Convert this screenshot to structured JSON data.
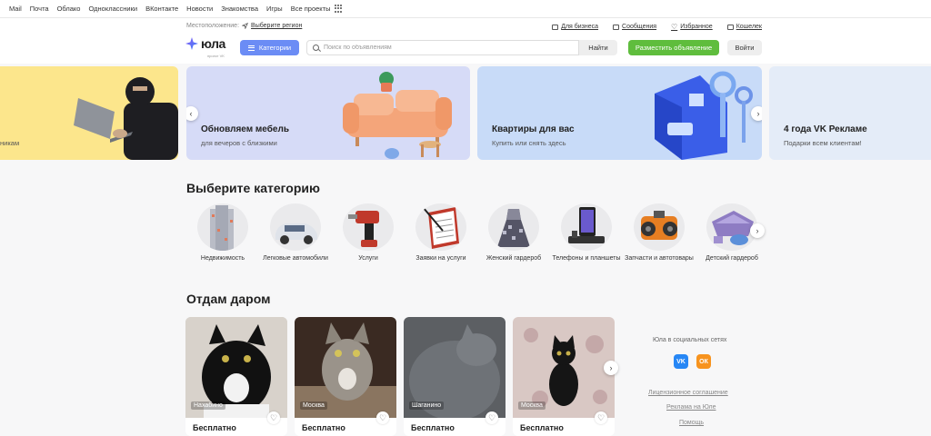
{
  "portal": {
    "links": [
      "Mail",
      "Почта",
      "Облако",
      "Одноклассники",
      "ВКонтакте",
      "Новости",
      "Знакомства",
      "Игры",
      "Все проекты"
    ]
  },
  "header": {
    "location_label": "Местоположение:",
    "location_link": "Выберите регион",
    "top_links": {
      "business": "Для бизнеса",
      "messages": "Сообщения",
      "favorites": "Избранное",
      "wallet": "Кошелек"
    },
    "logo_text": "юла",
    "logo_sub": "проект VK",
    "categories_button": "Категории",
    "search_placeholder": "Поиск по объявлениям",
    "find_button": "Найти",
    "post_button": "Разместить объявление",
    "login_button": "Войти"
  },
  "banners": [
    {
      "title": "",
      "subtitle": "никам"
    },
    {
      "title": "Обновляем мебель",
      "subtitle": "для вечеров с близкими"
    },
    {
      "title": "Квартиры для вас",
      "subtitle": "Купить или снять здесь"
    },
    {
      "title": "4 года VK Рекламе",
      "subtitle": "Подарки всем клиентам!"
    }
  ],
  "categories_section": {
    "title": "Выберите категорию",
    "items": [
      "Недвижимость",
      "Легковые автомобили",
      "Услуги",
      "Заявки на услуги",
      "Женский гардероб",
      "Телефоны и планшеты",
      "Запчасти и автотовары",
      "Детский гардероб"
    ]
  },
  "free_section": {
    "title": "Отдам даром",
    "cards": [
      {
        "city": "Нахабино",
        "price": "Бесплатно"
      },
      {
        "city": "Москва",
        "price": "Бесплатно"
      },
      {
        "city": "Шаганино",
        "price": "Бесплатно"
      },
      {
        "city": "Москва",
        "price": "Бесплатно"
      }
    ]
  },
  "side": {
    "social_title": "Юла в социальных сетях",
    "vk": "VK",
    "ok": "ОК",
    "links": [
      "Лицензионное соглашение",
      "Реклама на Юле",
      "Помощь"
    ]
  },
  "colors": {
    "accent_blue": "#6b8cf5",
    "post_green": "#5fbd3d",
    "vk_blue": "#2787f5",
    "ok_orange": "#f7931e"
  }
}
